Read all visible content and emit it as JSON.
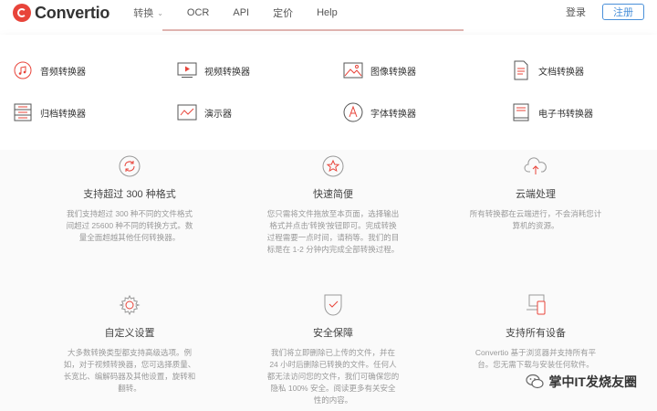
{
  "header": {
    "logo_text": "Convertio",
    "nav": [
      {
        "label": "转换",
        "has_caret": true
      },
      {
        "label": "OCR"
      },
      {
        "label": "API"
      },
      {
        "label": "定价"
      },
      {
        "label": "Help"
      }
    ],
    "login_label": "登录",
    "register_label": "注册"
  },
  "dropdown": {
    "items": [
      {
        "label": "音频转换器",
        "icon": "music-note-icon"
      },
      {
        "label": "视频转换器",
        "icon": "video-play-icon"
      },
      {
        "label": "图像转换器",
        "icon": "image-icon"
      },
      {
        "label": "文档转换器",
        "icon": "document-icon"
      },
      {
        "label": "归档转换器",
        "icon": "archive-icon"
      },
      {
        "label": "演示器",
        "icon": "presentation-icon"
      },
      {
        "label": "字体转换器",
        "icon": "font-icon"
      },
      {
        "label": "电子书转换器",
        "icon": "ebook-icon"
      }
    ]
  },
  "features": {
    "items": [
      {
        "title": "支持超过 300 种格式",
        "desc_lines": [
          "我们支持超过 300 种不同的文件格式",
          "间超过 25600 种不同的转换方式。数",
          "量全面超越其他任何转换器。"
        ]
      },
      {
        "title": "快速简便",
        "desc_lines": [
          "您只需将文件拖放至本页面，选择输出",
          "格式并点击'转换'按钮即可。完成转换",
          "过程需要一点时间，请稍等。我们的目",
          "标是在 1-2 分钟内完成全部转换过程。"
        ]
      },
      {
        "title": "云端处理",
        "desc_lines": [
          "所有转换都在云端进行，不会消耗您计",
          "算机的资源。"
        ]
      },
      {
        "title": "自定义设置",
        "desc_lines": [
          "大多数转换类型都支持高级选项。例",
          "如，对于视频转换器，您可选择质量、",
          "长宽比、编解码器及其他设置，旋转和",
          "翻转。"
        ]
      },
      {
        "title": "安全保障",
        "desc_lines": [
          "我们将立即删除已上传的文件，并在",
          "24 小时后删除已转换的文件。任何人",
          "都无法访问您的文件，我们可确保您的",
          "隐私 100% 安全。阅读更多有关安全",
          "性的内容。"
        ]
      },
      {
        "title": "支持所有设备",
        "desc_lines": [
          "Convertio 基于浏览器并支持所有平",
          "台。您无需下载与安装任何软件。"
        ]
      }
    ]
  },
  "watermark": {
    "text": "掌中IT发烧友圈"
  }
}
